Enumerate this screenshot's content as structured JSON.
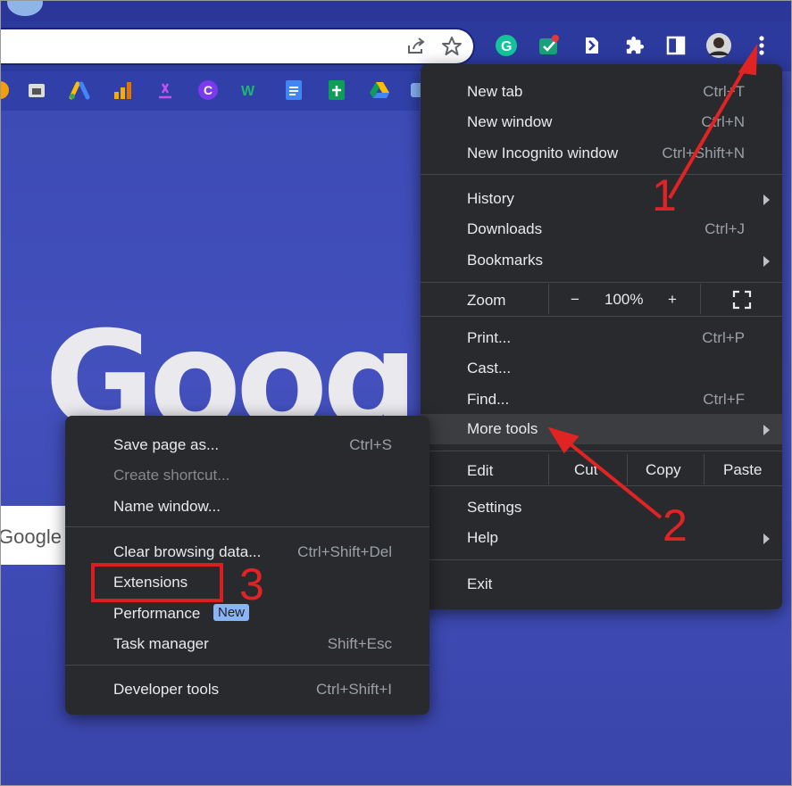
{
  "toolbar": {
    "omnibox_value": "",
    "share_icon": "share-icon",
    "star_icon": "bookmark-star-icon",
    "extensions": [
      "grammarly-icon",
      "evernote-icon",
      "clipper-icon",
      "puzzle-icon",
      "sidepanel-icon",
      "avatar",
      "kebab-menu-icon"
    ]
  },
  "bookmarks": [
    "bookmark-1",
    "bookmark-2",
    "google-ads-icon",
    "analytics-icon",
    "bookmark-5",
    "canva-icon",
    "bookmark-7",
    "google-docs-icon",
    "google-sheets-icon",
    "google-drive-icon",
    "bookmark-11"
  ],
  "page": {
    "logo_text": "Google",
    "search_placeholder": "Google"
  },
  "main_menu": {
    "group1": [
      {
        "label": "New tab",
        "shortcut": "Ctrl+T"
      },
      {
        "label": "New window",
        "shortcut": "Ctrl+N"
      },
      {
        "label": "New Incognito window",
        "shortcut": "Ctrl+Shift+N"
      }
    ],
    "group2": [
      {
        "label": "History",
        "shortcut": ""
      },
      {
        "label": "Downloads",
        "shortcut": "Ctrl+J"
      },
      {
        "label": "Bookmarks",
        "shortcut": ""
      }
    ],
    "zoom": {
      "label": "Zoom",
      "minus": "−",
      "value": "100%",
      "plus": "+"
    },
    "group3": [
      {
        "label": "Print...",
        "shortcut": "Ctrl+P"
      },
      {
        "label": "Cast...",
        "shortcut": ""
      },
      {
        "label": "Find...",
        "shortcut": "Ctrl+F"
      },
      {
        "label": "More tools",
        "shortcut": ""
      }
    ],
    "edit": {
      "label": "Edit",
      "cut": "Cut",
      "copy": "Copy",
      "paste": "Paste"
    },
    "group4": [
      {
        "label": "Settings"
      },
      {
        "label": "Help"
      }
    ],
    "exit": "Exit"
  },
  "sub_menu": {
    "group1": [
      {
        "label": "Save page as...",
        "shortcut": "Ctrl+S"
      },
      {
        "label": "Create shortcut...",
        "shortcut": ""
      },
      {
        "label": "Name window...",
        "shortcut": ""
      }
    ],
    "group2": [
      {
        "label": "Clear browsing data...",
        "shortcut": "Ctrl+Shift+Del"
      },
      {
        "label": "Extensions",
        "shortcut": ""
      },
      {
        "label": "Performance",
        "badge": "New"
      },
      {
        "label": "Task manager",
        "shortcut": "Shift+Esc"
      }
    ],
    "group3": [
      {
        "label": "Developer tools",
        "shortcut": "Ctrl+Shift+I"
      }
    ]
  },
  "annotations": {
    "step1": "1",
    "step2": "2",
    "step3": "3"
  },
  "colors": {
    "menu_bg": "#292a2d",
    "highlight": "#3c3d40",
    "annotation_red": "#e02424",
    "page_bg": "#3d4bb0"
  }
}
